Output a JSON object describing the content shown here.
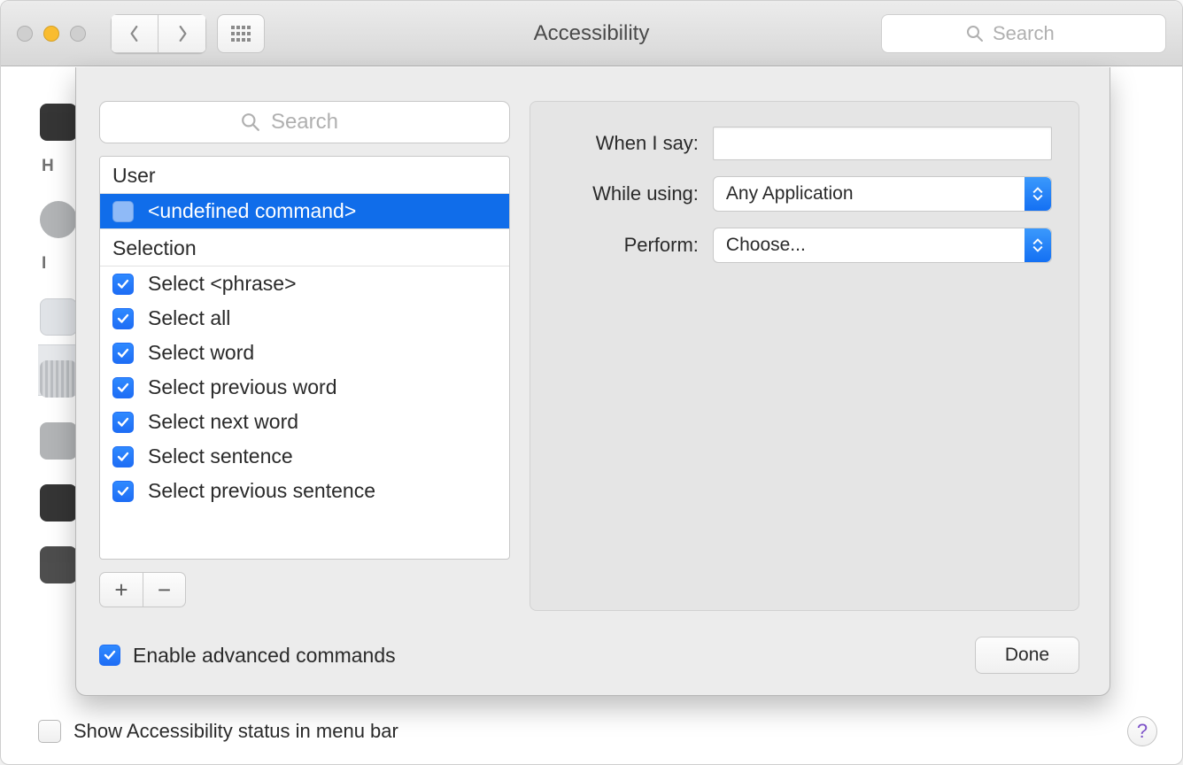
{
  "window": {
    "title": "Accessibility"
  },
  "toolbar": {
    "search_placeholder": "Search"
  },
  "bg_sidebar": {
    "letters": [
      "H",
      "I"
    ]
  },
  "sheet": {
    "left": {
      "search_placeholder": "Search",
      "sections": [
        {
          "header": "User",
          "rows": [
            {
              "label": "<undefined command>",
              "checked": false,
              "selected": true
            }
          ]
        },
        {
          "header": "Selection",
          "rows": [
            {
              "label": "Select <phrase>",
              "checked": true
            },
            {
              "label": "Select all",
              "checked": true
            },
            {
              "label": "Select word",
              "checked": true
            },
            {
              "label": "Select previous word",
              "checked": true
            },
            {
              "label": "Select next word",
              "checked": true
            },
            {
              "label": "Select sentence",
              "checked": true
            },
            {
              "label": "Select previous sentence",
              "checked": true
            }
          ]
        }
      ],
      "add_label": "+",
      "remove_label": "−"
    },
    "right": {
      "when_label": "When I say:",
      "while_label": "While using:",
      "perform_label": "Perform:",
      "when_value": "",
      "while_value": "Any Application",
      "perform_value": "Choose..."
    },
    "enable_label": "Enable advanced commands",
    "enable_checked": true,
    "done_label": "Done"
  },
  "footer": {
    "status_label": "Show Accessibility status in menu bar",
    "status_checked": false,
    "help_label": "?"
  }
}
